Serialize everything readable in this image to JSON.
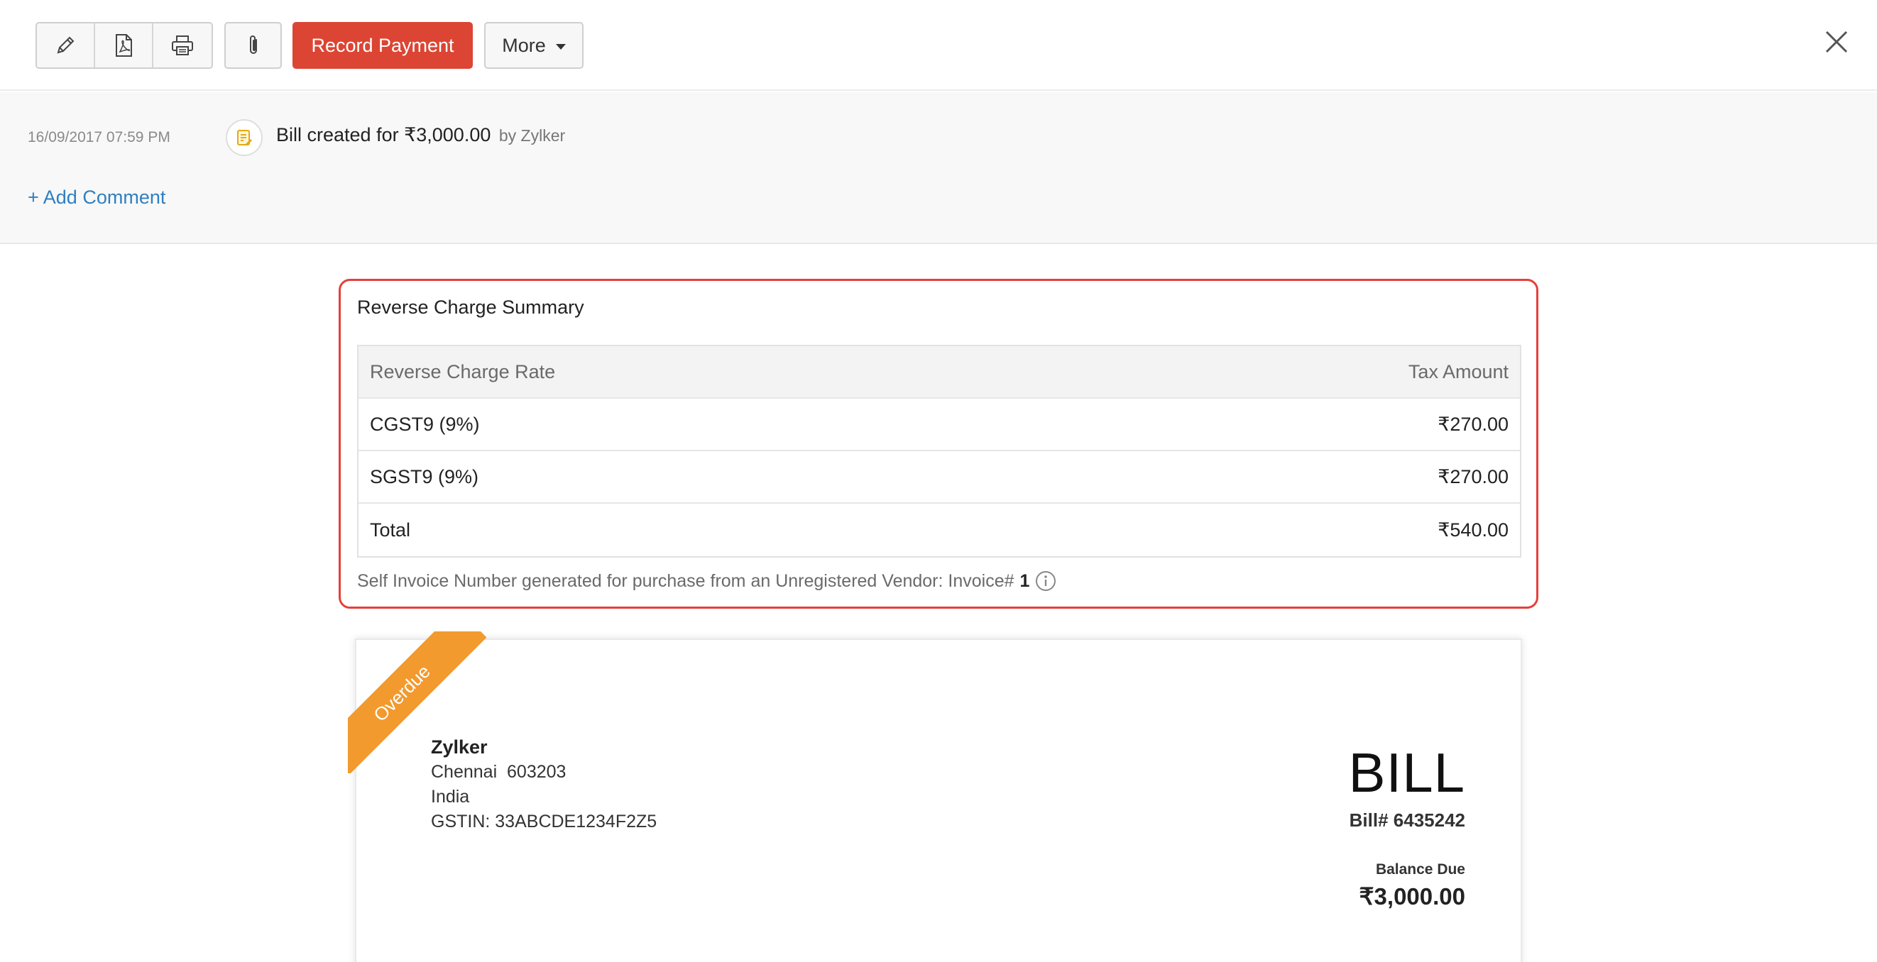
{
  "toolbar": {
    "icons": [
      "pencil-icon",
      "pdf-icon",
      "printer-icon",
      "paperclip-icon"
    ],
    "record_payment_label": "Record Payment",
    "more_label": "More",
    "accent": "#dc4533"
  },
  "activity": {
    "timestamp": "16/09/2017 07:59 PM",
    "message": "Bill created for ₹3,000.00",
    "by": "by Zylker",
    "add_comment_label": "+ Add Comment"
  },
  "reverse_charge": {
    "title": "Reverse Charge Summary",
    "columns": [
      "Reverse Charge Rate",
      "Tax Amount"
    ],
    "rows": [
      {
        "rate": "CGST9 (9%)",
        "amount": "₹270.00"
      },
      {
        "rate": "SGST9 (9%)",
        "amount": "₹270.00"
      },
      {
        "rate": "Total",
        "amount": "₹540.00"
      }
    ],
    "note": "Self Invoice Number generated for purchase from an Unregistered Vendor: Invoice#",
    "invoice_number": "1",
    "border_color": "#e4403b"
  },
  "bill": {
    "status_ribbon": "Overdue",
    "ribbon_color": "#f29a2e",
    "vendor_name": "Zylker",
    "vendor_city": "Chennai  603203",
    "vendor_country": "India",
    "vendor_gstin": "GSTIN: 33ABCDE1234F2Z5",
    "title": "BILL",
    "number": "Bill# 6435242",
    "balance_label": "Balance Due",
    "balance_amount": "₹3,000.00"
  }
}
